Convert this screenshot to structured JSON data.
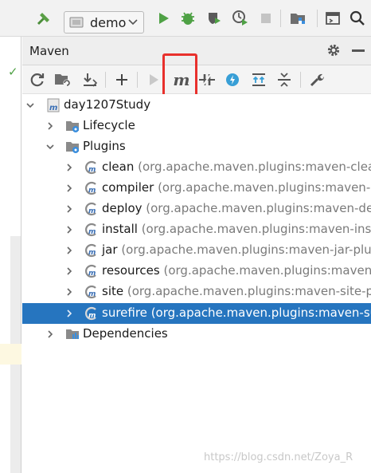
{
  "toolbar": {
    "run_config": "demo",
    "buttons": [
      "build-icon",
      "run-icon",
      "debug-icon",
      "coverage-icon",
      "profile-icon",
      "stop-icon",
      "project-structure-icon",
      "layout-icon",
      "search-icon"
    ]
  },
  "panel": {
    "title": "Maven",
    "actions": [
      "reload-icon",
      "generate-sources-icon",
      "download-icon",
      "add-icon",
      "run-icon",
      "execute-goal-icon",
      "toggle-offline-icon",
      "skip-tests-icon",
      "show-dependencies-icon",
      "collapse-all-icon",
      "settings-icon"
    ]
  },
  "tree": {
    "root": "day1207Study",
    "lifecycle": "Lifecycle",
    "plugins": "Plugins",
    "dependencies": "Dependencies",
    "plugin_items": [
      {
        "name": "clean",
        "detail": "(org.apache.maven.plugins:maven-clean-"
      },
      {
        "name": "compiler",
        "detail": "(org.apache.maven.plugins:maven-co"
      },
      {
        "name": "deploy",
        "detail": "(org.apache.maven.plugins:maven-dep"
      },
      {
        "name": "install",
        "detail": "(org.apache.maven.plugins:maven-instal"
      },
      {
        "name": "jar",
        "detail": "(org.apache.maven.plugins:maven-jar-plugi"
      },
      {
        "name": "resources",
        "detail": "(org.apache.maven.plugins:maven-re"
      },
      {
        "name": "site",
        "detail": "(org.apache.maven.plugins:maven-site-plu"
      },
      {
        "name": "surefire",
        "detail": "(org.apache.maven.plugins:maven-sure"
      }
    ],
    "selected_index": 7
  },
  "colors": {
    "selection": "#2675bf",
    "highlight_box": "#e8302c",
    "run_green": "#4fa145"
  },
  "watermark": "https://blog.csdn.net/Zoya_R"
}
